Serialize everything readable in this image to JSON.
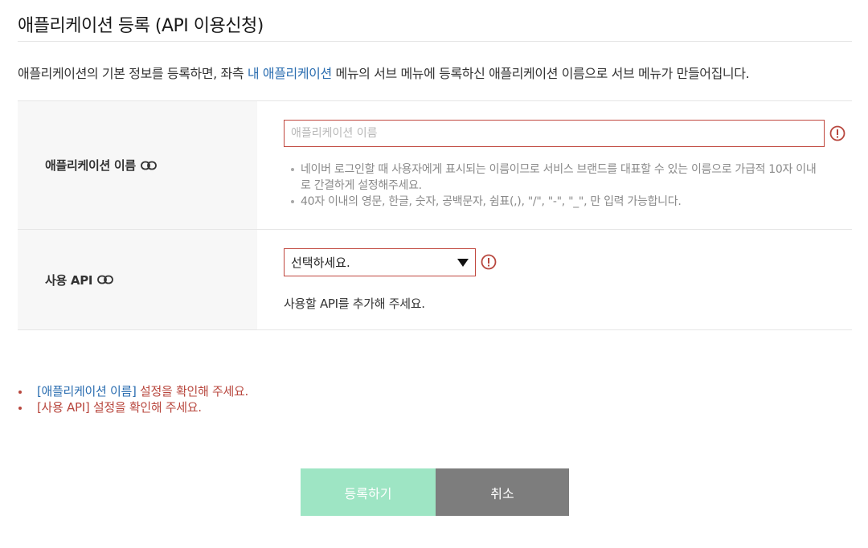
{
  "page": {
    "title": "애플리케이션 등록 (API 이용신청)",
    "intro_before": "애플리케이션의 기본 정보를 등록하면, 좌측 ",
    "intro_link": "내 애플리케이션",
    "intro_after": " 메뉴의 서브 메뉴에 등록하신 애플리케이션 이름으로 서브 메뉴가 만들어집니다."
  },
  "form": {
    "app_name": {
      "label": "애플리케이션 이름",
      "placeholder": "애플리케이션 이름",
      "value": "",
      "hints": [
        "네이버 로그인할 때 사용자에게 표시되는 이름이므로 서비스 브랜드를 대표할 수 있는 이름으로 가급적 10자 이내로 간결하게 설정해주세요.",
        "40자 이내의 영문, 한글, 숫자, 공백문자, 쉼표(,), \"/\", \"-\", \"_\", 만 입력 가능합니다."
      ]
    },
    "api": {
      "label": "사용 API",
      "selected": "선택하세요.",
      "hint": "사용할 API를 추가해 주세요."
    }
  },
  "errors": [
    {
      "field": "[애플리케이션 이름]",
      "message": " 설정을 확인해 주세요."
    },
    {
      "field": "",
      "message": "[사용 API] 설정을 확인해 주세요."
    }
  ],
  "buttons": {
    "register": "등록하기",
    "cancel": "취소"
  },
  "colors": {
    "error": "#b8473e",
    "link": "#2a6db0",
    "register_bg": "#9ee5c4",
    "cancel_bg": "#7d7d7d"
  }
}
